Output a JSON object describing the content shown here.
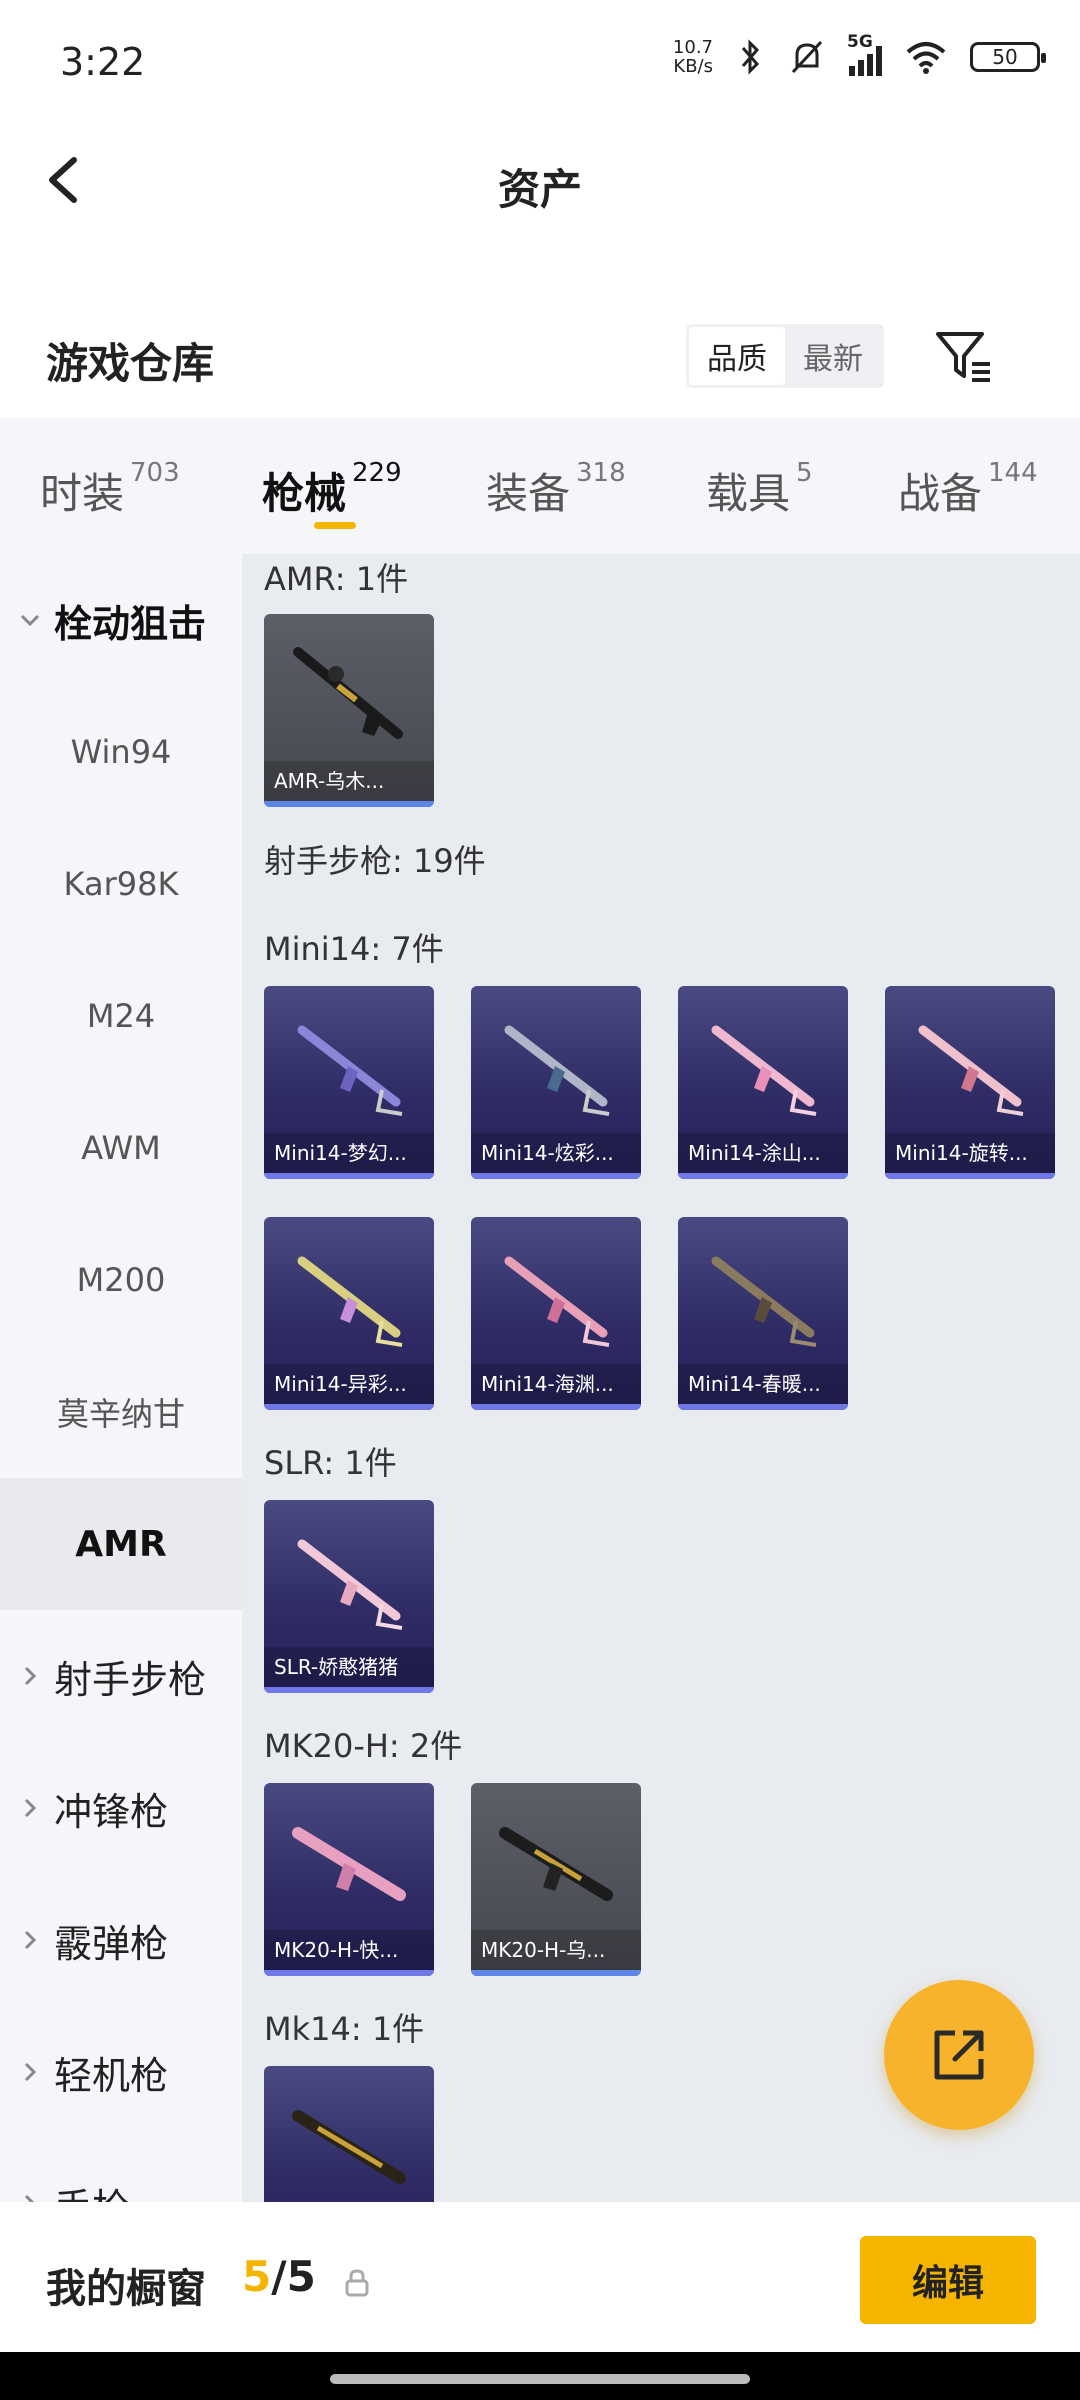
{
  "status_bar": {
    "time": "3:22",
    "net_speed_value": "10.7",
    "net_speed_unit": "KB/s",
    "network_type": "5G",
    "battery": "50"
  },
  "header": {
    "title": "资产"
  },
  "warehouse": {
    "title": "游戏仓库",
    "sort_options": [
      "品质",
      "最新"
    ],
    "sort_selected": "品质"
  },
  "tabs": [
    {
      "label": "时装",
      "count": "703"
    },
    {
      "label": "枪械",
      "count": "229"
    },
    {
      "label": "装备",
      "count": "318"
    },
    {
      "label": "载具",
      "count": "5"
    },
    {
      "label": "战备",
      "count": "144"
    }
  ],
  "active_tab": "枪械",
  "sidebar": {
    "items": [
      {
        "label": "栓动狙击",
        "type": "group-open"
      },
      {
        "label": "Win94",
        "type": "sub"
      },
      {
        "label": "Kar98K",
        "type": "sub"
      },
      {
        "label": "M24",
        "type": "sub"
      },
      {
        "label": "AWM",
        "type": "sub"
      },
      {
        "label": "M200",
        "type": "sub"
      },
      {
        "label": "莫辛纳甘",
        "type": "sub"
      },
      {
        "label": "AMR",
        "type": "active"
      },
      {
        "label": "射手步枪",
        "type": "group"
      },
      {
        "label": "冲锋枪",
        "type": "group"
      },
      {
        "label": "霰弹枪",
        "type": "group"
      },
      {
        "label": "轻机枪",
        "type": "group"
      },
      {
        "label": "手枪",
        "type": "group"
      }
    ]
  },
  "content": {
    "sections": [
      {
        "label": "AMR: 1件"
      },
      {
        "label": "射手步枪: 19件"
      },
      {
        "label": "Mini14: 7件"
      },
      {
        "label": "SLR: 1件"
      },
      {
        "label": "MK20-H: 2件"
      },
      {
        "label": "Mk14: 1件"
      }
    ],
    "items": [
      {
        "name": "AMR-乌木...",
        "rarity": "gray"
      },
      {
        "name": "Mini14-梦幻...",
        "rarity": "purple"
      },
      {
        "name": "Mini14-炫彩...",
        "rarity": "purple"
      },
      {
        "name": "Mini14-涂山...",
        "rarity": "purple"
      },
      {
        "name": "Mini14-旋转...",
        "rarity": "purple"
      },
      {
        "name": "Mini14-异彩...",
        "rarity": "purple"
      },
      {
        "name": "Mini14-海渊...",
        "rarity": "purple"
      },
      {
        "name": "Mini14-春暖...",
        "rarity": "purple"
      },
      {
        "name": "SLR-娇憨猪猪",
        "rarity": "purple"
      },
      {
        "name": "MK20-H-快...",
        "rarity": "purple"
      },
      {
        "name": "MK20-H-乌...",
        "rarity": "gray"
      },
      {
        "name": "",
        "rarity": "purple"
      }
    ]
  },
  "bottom": {
    "label": "我的橱窗",
    "current": "5",
    "separator": "/",
    "max": "5",
    "edit_label": "编辑"
  },
  "colors": {
    "accent": "#f5b400",
    "purple_card": "#2e2a64",
    "gray_card": "#4e5058"
  }
}
